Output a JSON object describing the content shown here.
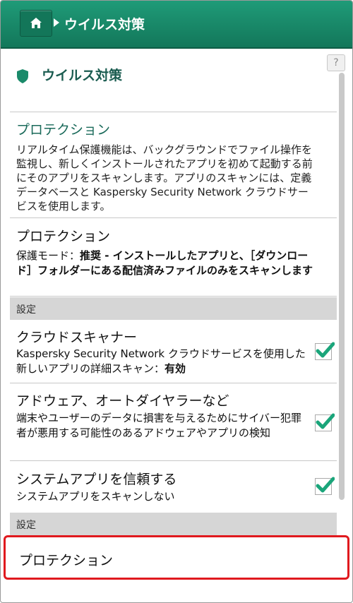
{
  "header": {
    "title": "ウイルス対策"
  },
  "help": {
    "label": "?"
  },
  "page_title": "ウイルス対策",
  "info": {
    "title": "プロテクション",
    "description": "リアルタイム保護機能は、バックグラウンドでファイル操作を監視し、新しくインストールされたアプリを初めて起動する前にそのアプリをスキャンします。アプリのスキャンには、定義データベースと Kaspersky Security Network クラウドサービスを使用します。"
  },
  "protection": {
    "title": "プロテクション",
    "mode_label": "保護モード：",
    "mode_value": "推奨 - インストールしたアプリと、［ダウンロード］フォルダーにある配信済みファイルのみをスキャンします"
  },
  "section1": "設定",
  "cloud": {
    "title": "クラウドスキャナー",
    "desc_prefix": "Kaspersky Security Network クラウドサービスを使用した新しいアプリの詳細スキャン：",
    "desc_value": "有効",
    "checked": true
  },
  "adware": {
    "title": "アドウェア、オートダイヤラーなど",
    "desc": "端末やユーザーのデータに損害を与えるためにサイバー犯罪者が悪用する可能性のあるアドウェアやアプリの検知",
    "checked": true
  },
  "system": {
    "title": "システムアプリを信頼する",
    "desc": "システムアプリをスキャンしない",
    "checked": true
  },
  "section2": "設定",
  "highlighted": {
    "title": "プロテクション"
  },
  "colors": {
    "brand": "#1a8a6a",
    "check": "#1aa57a",
    "highlight": "#e0191e"
  }
}
